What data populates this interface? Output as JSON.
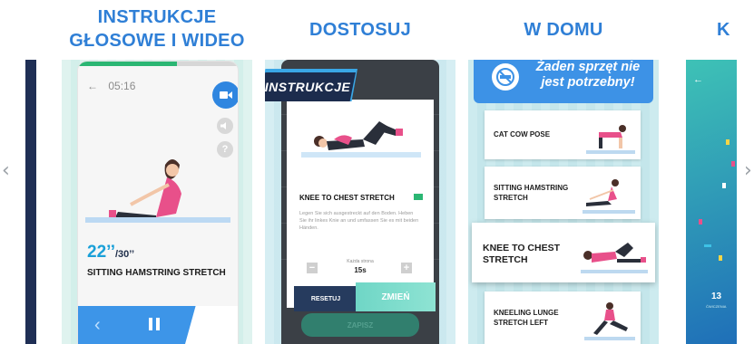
{
  "navigation": {
    "prev_glyph": "‹",
    "next_glyph": "›"
  },
  "slides": [
    {
      "heading_line1": "INSTRUKCJE",
      "heading_line2": "GŁOSOWE I WIDEO",
      "screen": {
        "back_glyph": "←",
        "time": "05:16",
        "timer_current": "22’’",
        "timer_total": "/30’’",
        "exercise_name": "SITTING HAMSTRING STRETCH",
        "progress": 0.62,
        "icons": [
          "video-camera-icon",
          "speaker-icon",
          "help-icon"
        ],
        "help_glyph": "?"
      }
    },
    {
      "heading": "DOSTOSUJ",
      "screen": {
        "banner": "INSTRUKCJE",
        "exercise_name": "KNEE TO CHEST STRETCH",
        "description": "Legen Sie sich ausgestreckt auf den Boden. Heben Sie ihr linkes Knie an und umfassen Sie es mit beiden Händen.",
        "count_label": "Każda strona",
        "minus_glyph": "−",
        "plus_glyph": "+",
        "count_value": "15s",
        "reset_label": "RESETUJ",
        "change_label": "ZMIEŃ",
        "save_label": "ZAPISZ"
      }
    },
    {
      "heading": "W DOMU",
      "banner": "Żaden sprzęt nie jest potrzebny!",
      "exercises": [
        "CAT COW POSE",
        "SITTING HAMSTRING STRETCH",
        "KNEE TO CHEST STRETCH",
        "KNEELING LUNGE STRETCH LEFT"
      ]
    },
    {
      "heading": "K",
      "screen": {
        "back_glyph": "←",
        "number": "13",
        "caption": "ĆWICZENIA"
      }
    }
  ],
  "colors": {
    "heading_blue": "#2f7fd6",
    "accent_blue": "#3d92e6",
    "teal": "#6fd6c6",
    "navy": "#1c2c4d",
    "pink": "#e8508a"
  }
}
